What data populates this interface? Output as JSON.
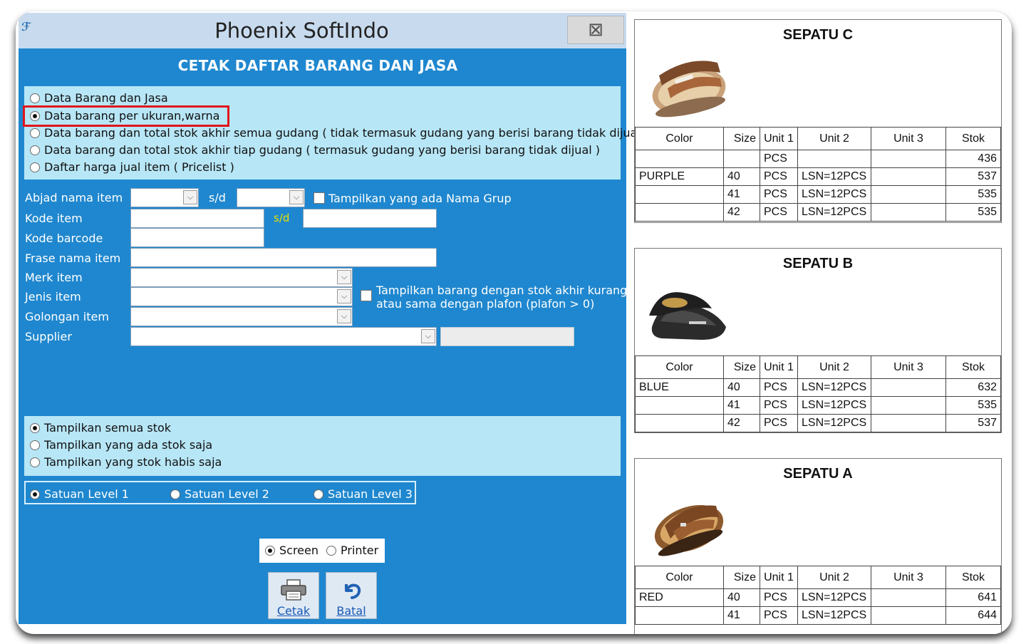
{
  "window": {
    "title": "Phoenix SoftIndo",
    "close_glyph": "⊠"
  },
  "dialog": {
    "heading": "CETAK DAFTAR BARANG DAN JASA",
    "report_options": [
      {
        "label": "Data Barang dan Jasa",
        "selected": false
      },
      {
        "label": "Data barang per ukuran,warna",
        "selected": true
      },
      {
        "label": "Data barang dan total stok akhir semua gudang ( tidak termasuk gudang yang berisi barang tidak dijual )",
        "selected": false
      },
      {
        "label": "Data barang dan total stok akhir tiap gudang ( termasuk gudang yang berisi barang tidak dijual )",
        "selected": false
      },
      {
        "label": "Daftar harga jual item ( Pricelist )",
        "selected": false
      }
    ],
    "filters": {
      "abjad_label": "Abjad nama item",
      "sd_label": "s/d",
      "group_check_label": "Tampilkan yang ada Nama Grup",
      "kode_item_label": "Kode item",
      "kode_item_sd": "s/d",
      "kode_barcode_label": "Kode barcode",
      "frase_label": "Frase nama item",
      "merk_label": "Merk item",
      "jenis_label": "Jenis item",
      "golongan_label": "Golongan item",
      "supplier_label": "Supplier",
      "plafon_check_label_1": "Tampilkan barang dengan stok akhir kurang",
      "plafon_check_label_2": "atau sama dengan plafon (plafon > 0)"
    },
    "stock_options": [
      {
        "label": "Tampilkan semua stok",
        "selected": true
      },
      {
        "label": "Tampilkan yang ada stok saja",
        "selected": false
      },
      {
        "label": "Tampilkan yang stok habis saja",
        "selected": false
      }
    ],
    "unit_levels": [
      {
        "label": "Satuan Level 1",
        "selected": true
      },
      {
        "label": "Satuan Level 2",
        "selected": false
      },
      {
        "label": "Satuan Level 3",
        "selected": false
      }
    ],
    "output": {
      "screen": "Screen",
      "printer": "Printer",
      "selected": "Screen"
    },
    "buttons": {
      "print": "Cetak",
      "cancel": "Batal"
    }
  },
  "products": [
    {
      "title": "SEPATU C",
      "headers": [
        "Color",
        "Size",
        "Unit 1",
        "Unit 2",
        "Unit 3",
        "Stok"
      ],
      "rows": [
        [
          "",
          "",
          "PCS",
          "",
          "",
          "436"
        ],
        [
          "PURPLE",
          "40",
          "PCS",
          "LSN=12PCS",
          "",
          "537"
        ],
        [
          "",
          "41",
          "PCS",
          "LSN=12PCS",
          "",
          "535"
        ],
        [
          "",
          "42",
          "PCS",
          "LSN=12PCS",
          "",
          "535"
        ]
      ]
    },
    {
      "title": "SEPATU B",
      "headers": [
        "Color",
        "Size",
        "Unit 1",
        "Unit 2",
        "Unit 3",
        "Stok"
      ],
      "rows": [
        [
          "BLUE",
          "40",
          "PCS",
          "LSN=12PCS",
          "",
          "632"
        ],
        [
          "",
          "41",
          "PCS",
          "LSN=12PCS",
          "",
          "535"
        ],
        [
          "",
          "42",
          "PCS",
          "LSN=12PCS",
          "",
          "537"
        ]
      ]
    },
    {
      "title": "SEPATU A",
      "headers": [
        "Color",
        "Size",
        "Unit 1",
        "Unit 2",
        "Unit 3",
        "Stok"
      ],
      "rows": [
        [
          "RED",
          "40",
          "PCS",
          "LSN=12PCS",
          "",
          "641"
        ],
        [
          "",
          "41",
          "PCS",
          "LSN=12PCS",
          "",
          "644"
        ]
      ]
    }
  ]
}
